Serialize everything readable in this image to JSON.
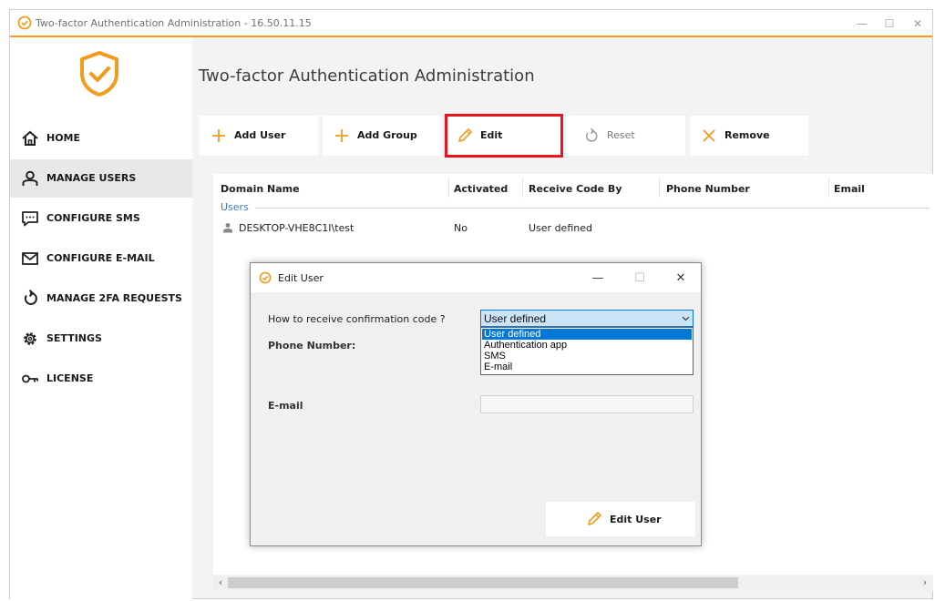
{
  "window": {
    "title": "Two-factor Authentication Administration - 16.50.11.15",
    "minimize": "—",
    "maximize": "☐",
    "close": "✕"
  },
  "colors": {
    "accent": "#f29b1d",
    "highlight_border": "#e8141f",
    "selection": "#0078d7",
    "group_label": "#3a78c2"
  },
  "sidebar": {
    "logo_icon": "shield-check-icon",
    "items": [
      {
        "label": "HOME",
        "icon": "home-icon"
      },
      {
        "label": "MANAGE USERS",
        "icon": "user-icon",
        "active": true
      },
      {
        "label": "CONFIGURE SMS",
        "icon": "message-icon"
      },
      {
        "label": "CONFIGURE E-MAIL",
        "icon": "envelope-icon"
      },
      {
        "label": "MANAGE 2FA REQUESTS",
        "icon": "refresh-icon"
      },
      {
        "label": "SETTINGS",
        "icon": "gear-icon"
      },
      {
        "label": "LICENSE",
        "icon": "key-icon"
      }
    ]
  },
  "main": {
    "title": "Two-factor Authentication Administration"
  },
  "toolbar": {
    "add_user": "Add User",
    "add_group": "Add Group",
    "edit": "Edit",
    "reset": "Reset",
    "remove": "Remove"
  },
  "table": {
    "columns": [
      "Domain Name",
      "Activated",
      "Receive Code By",
      "Phone Number",
      "Email"
    ],
    "group": "Users",
    "rows": [
      {
        "domain_name": "DESKTOP-VHE8C1I\\test",
        "activated": "No",
        "receive_code_by": "User defined",
        "phone_number": "",
        "email": ""
      }
    ]
  },
  "scrollbar": {
    "left_arrow": "‹",
    "right_arrow": "›"
  },
  "dialog": {
    "title": "Edit User",
    "minimize": "—",
    "maximize": "☐",
    "close": "✕",
    "code_label": "How to receive confirmation code ?",
    "selected_option": "User defined",
    "options": [
      "User defined",
      "Authentication app",
      "SMS",
      "E-mail"
    ],
    "phone_label": "Phone Number:",
    "email_label": "E-mail",
    "email_value": "",
    "submit": "Edit User"
  }
}
